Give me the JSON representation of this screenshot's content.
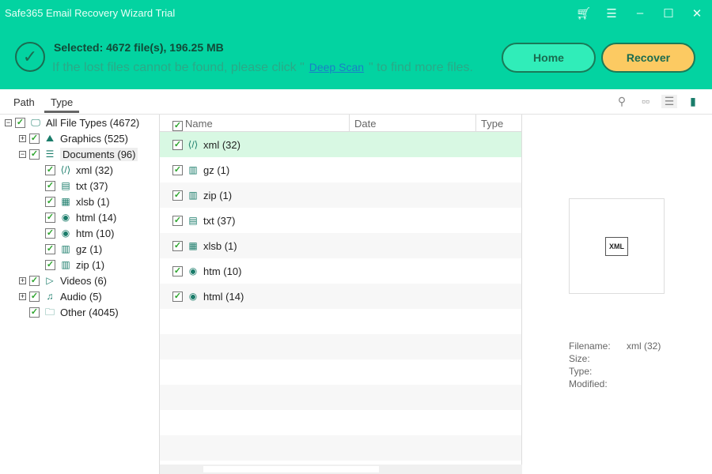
{
  "window": {
    "title": "Safe365 Email Recovery Wizard Trial",
    "buttons": [
      "cart",
      "menu",
      "minimize",
      "maximize",
      "close"
    ]
  },
  "banner": {
    "selected": "Selected: 4672 file(s), 196.25 MB",
    "hint_before": "If the lost files cannot be found, please click \"",
    "deep_scan": "Deep Scan",
    "hint_after": "\" to find more files.",
    "home": "Home",
    "recover": "Recover"
  },
  "tabs": {
    "path": "Path",
    "type": "Type"
  },
  "tree": {
    "root": "All File Types (4672)",
    "graphics": "Graphics (525)",
    "documents": "Documents (96)",
    "docs": [
      "xml (32)",
      "txt (37)",
      "xlsb (1)",
      "html (14)",
      "htm (10)",
      "gz (1)",
      "zip (1)"
    ],
    "videos": "Videos (6)",
    "audio": "Audio (5)",
    "other": "Other (4045)"
  },
  "list": {
    "columns": {
      "name": "Name",
      "date": "Date",
      "type": "Type"
    },
    "rows": [
      "xml (32)",
      "gz (1)",
      "zip (1)",
      "txt (37)",
      "xlsb (1)",
      "htm (10)",
      "html (14)"
    ]
  },
  "preview": {
    "filename_label": "Filename:",
    "filename": "xml (32)",
    "size_label": "Size:",
    "type_label": "Type:",
    "modified_label": "Modified:",
    "thumb_label": "XML"
  }
}
